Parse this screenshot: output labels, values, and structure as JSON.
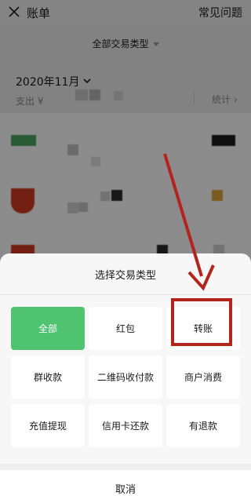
{
  "header": {
    "title": "账单",
    "faq_label": "常见问题"
  },
  "filter": {
    "label": "全部交易类型"
  },
  "summary": {
    "month": "2020年11月",
    "spend_label": "支出 ¥",
    "stats_label": "统计"
  },
  "sheet": {
    "title": "选择交易类型",
    "options": [
      {
        "label": "全部",
        "selected": true
      },
      {
        "label": "红包",
        "selected": false
      },
      {
        "label": "转账",
        "selected": false
      },
      {
        "label": "群收款",
        "selected": false
      },
      {
        "label": "二维码收付款",
        "selected": false
      },
      {
        "label": "商户消费",
        "selected": false
      },
      {
        "label": "充值提现",
        "selected": false
      },
      {
        "label": "信用卡还款",
        "selected": false
      },
      {
        "label": "有退款",
        "selected": false
      }
    ],
    "cancel_label": "取消"
  },
  "colors": {
    "accent": "#4fc36f",
    "annotation": "#b3241c"
  }
}
